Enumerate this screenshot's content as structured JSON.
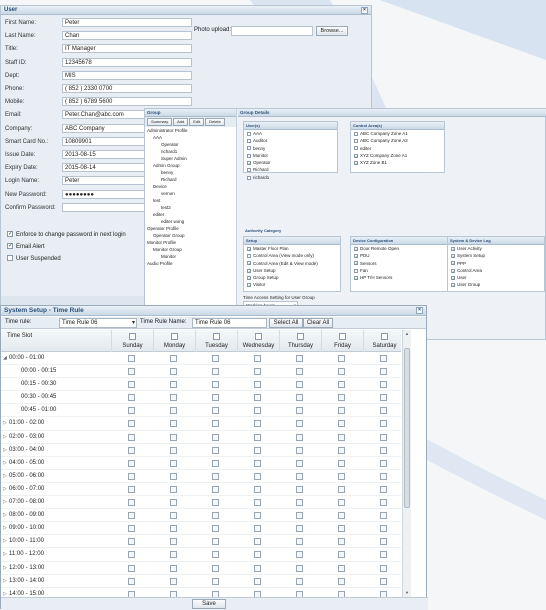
{
  "user_window": {
    "title": "User",
    "fields": [
      {
        "label": "First Name:",
        "value": "Peter"
      },
      {
        "label": "Last Name:",
        "value": "Chan"
      },
      {
        "label": "Title:",
        "value": "IT Manager"
      },
      {
        "label": "Staff ID:",
        "value": "12345678"
      },
      {
        "label": "Dept:",
        "value": "MIS"
      },
      {
        "label": "Phone:",
        "value": "( 852 ) 2330 0700"
      },
      {
        "label": "Mobile:",
        "value": "( 852 ) 6789 5600"
      },
      {
        "label": "Email:",
        "value": "Peter.Chan@abc.com"
      },
      {
        "label": "Company:",
        "value": "ABC Company"
      },
      {
        "label": "Smart Card No.:",
        "value": "10809901"
      },
      {
        "label": "Issue Date:",
        "value": "2013-08-15"
      },
      {
        "label": "Expiry Date:",
        "value": "2015-08-14"
      },
      {
        "label": "Login Name:",
        "value": "Peter"
      },
      {
        "label": "New Password:",
        "value": "●●●●●●●●"
      },
      {
        "label": "Confirm Password:",
        "value": ""
      }
    ],
    "checkboxes": [
      {
        "label": "Enforce to change password in next login",
        "checked": true
      },
      {
        "label": "Email Alert",
        "checked": true
      },
      {
        "label": "User Suspended",
        "checked": false
      }
    ],
    "photo_label": "Photo upload:",
    "browse_label": "Browse..."
  },
  "group_window": {
    "title": "Group",
    "details_title": "Group Details",
    "buttons": [
      "Summary",
      "Add",
      "Edit",
      "Delete"
    ],
    "tree": [
      "Administrator Profile",
      "AAA",
      "Operator",
      "richard1",
      "Super Admin",
      "Admin Group",
      "benny",
      "Richard",
      "Device",
      "vernon",
      "test",
      "test2",
      "editer",
      "editer wong",
      "Operator Profile",
      "Operator Group",
      "Monitor Profile",
      "Monitor Group",
      "Monitor",
      "Audio Profile"
    ],
    "users_title": "User(s)",
    "users": [
      {
        "name": "AAA",
        "checked": false
      },
      {
        "name": "Auditor",
        "checked": false
      },
      {
        "name": "benny",
        "checked": false
      },
      {
        "name": "Monitor",
        "checked": false
      },
      {
        "name": "Operator",
        "checked": true
      },
      {
        "name": "Richard",
        "checked": false
      },
      {
        "name": "richard1",
        "checked": false
      }
    ],
    "areas_title": "Control Area(s)",
    "areas": [
      {
        "name": "ABC Company Zone A1",
        "checked": false
      },
      {
        "name": "ABC Company Zone A2",
        "checked": false
      },
      {
        "name": "editer",
        "checked": false
      },
      {
        "name": "XYZ Company Zone A1",
        "checked": true
      },
      {
        "name": "XYZ Zone B1",
        "checked": true
      }
    ],
    "authority_title": "Authority Category",
    "setup_title": "Setup",
    "setup": [
      {
        "name": "Master Floor Plan",
        "checked": true
      },
      {
        "name": "Control Area (View mode only)",
        "checked": false
      },
      {
        "name": "Control Area (Edit & View mode)",
        "checked": true
      },
      {
        "name": "User Setup",
        "checked": true
      },
      {
        "name": "Group Setup",
        "checked": true
      },
      {
        "name": "Visitor",
        "checked": true
      }
    ],
    "devconf_title": "Device Configuration",
    "devconf": [
      {
        "name": "Door Remote Open",
        "checked": true
      },
      {
        "name": "PDU",
        "checked": true
      },
      {
        "name": "Sensors",
        "checked": true
      },
      {
        "name": "Fan",
        "checked": false
      },
      {
        "name": "HP T/H Sensors",
        "checked": true
      }
    ],
    "syslog_title": "System & Device Log",
    "syslog": [
      {
        "name": "User Activity",
        "checked": true
      },
      {
        "name": "System Setup",
        "checked": true
      },
      {
        "name": "PPP",
        "checked": true
      },
      {
        "name": "Control Area",
        "checked": true
      },
      {
        "name": "User",
        "checked": true
      },
      {
        "name": "User Group",
        "checked": true
      }
    ],
    "time_access_label": "Time Access Setting for User Group",
    "time_access_value": "Working hours"
  },
  "time_window": {
    "title": "System Setup - Time Rule",
    "time_rule_label": "Time rule:",
    "time_rule_value": "Time Rule 06",
    "time_rule_name_label": "Time Rule Name:",
    "time_rule_name_value": "Time Rule 06",
    "select_all": "Select All",
    "clear_all": "Clear All",
    "timeslot_header": "Time Slot",
    "days": [
      "Sunday",
      "Monday",
      "Tuesday",
      "Wednesday",
      "Thursday",
      "Friday",
      "Saturday"
    ],
    "slots": [
      {
        "label": "00:00 - 01:00",
        "level": 0,
        "expanded": true
      },
      {
        "label": "00:00 - 00:15",
        "level": 1
      },
      {
        "label": "00:15 - 00:30",
        "level": 1
      },
      {
        "label": "00:30 - 00:45",
        "level": 1
      },
      {
        "label": "00:45 - 01:00",
        "level": 1
      },
      {
        "label": "01:00 - 02:00",
        "level": 0
      },
      {
        "label": "02:00 - 03:00",
        "level": 0
      },
      {
        "label": "03:00 - 04:00",
        "level": 0
      },
      {
        "label": "04:00 - 05:00",
        "level": 0
      },
      {
        "label": "05:00 - 06:00",
        "level": 0
      },
      {
        "label": "06:00 - 07:00",
        "level": 0
      },
      {
        "label": "07:00 - 08:00",
        "level": 0
      },
      {
        "label": "08:00 - 09:00",
        "level": 0
      },
      {
        "label": "09:00 - 10:00",
        "level": 0
      },
      {
        "label": "10:00 - 11:00",
        "level": 0
      },
      {
        "label": "11:00 - 12:00",
        "level": 0
      },
      {
        "label": "12:00 - 13:00",
        "level": 0
      },
      {
        "label": "13:00 - 14:00",
        "level": 0
      },
      {
        "label": "14:00 - 15:00",
        "level": 0
      },
      {
        "label": "15:00 - 16:00",
        "level": 0
      }
    ],
    "save_label": "Save"
  }
}
